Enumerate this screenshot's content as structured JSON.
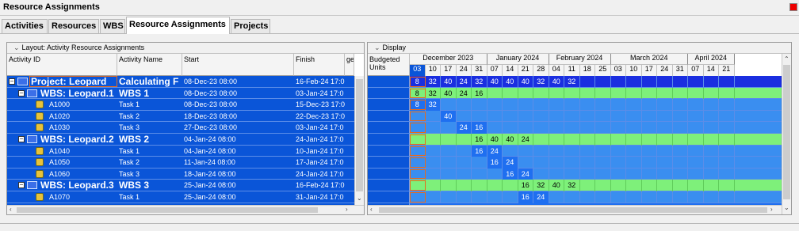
{
  "window": {
    "title": "Resource Assignments"
  },
  "tabs": [
    {
      "label": "Activities"
    },
    {
      "label": "Resources"
    },
    {
      "label": "WBS"
    },
    {
      "label": "Resource Assignments"
    },
    {
      "label": "Projects"
    }
  ],
  "left_panel": {
    "layout_label": "Layout: Activity Resource Assignments",
    "columns": [
      "Activity ID",
      "Activity Name",
      "Start",
      "Finish",
      "ge"
    ],
    "rows": [
      {
        "type": "proj",
        "id": "Project: Leopard",
        "name": "Calculating F",
        "start": "08-Dec-23 08:00",
        "finish": "16-Feb-24 17:0"
      },
      {
        "type": "wbs",
        "id": "WBS: Leopard.1",
        "name": "WBS 1",
        "start": "08-Dec-23 08:00",
        "finish": "03-Jan-24 17:0"
      },
      {
        "type": "act",
        "id": "A1000",
        "name": "Task 1",
        "start": "08-Dec-23 08:00",
        "finish": "15-Dec-23 17:0"
      },
      {
        "type": "act",
        "id": "A1020",
        "name": "Task 2",
        "start": "18-Dec-23 08:00",
        "finish": "22-Dec-23 17:0"
      },
      {
        "type": "act",
        "id": "A1030",
        "name": "Task 3",
        "start": "27-Dec-23 08:00",
        "finish": "03-Jan-24 17:0"
      },
      {
        "type": "wbs",
        "id": "WBS: Leopard.2",
        "name": "WBS 2",
        "start": "04-Jan-24 08:00",
        "finish": "24-Jan-24 17:0"
      },
      {
        "type": "act",
        "id": "A1040",
        "name": "Task 1",
        "start": "04-Jan-24 08:00",
        "finish": "10-Jan-24 17:0"
      },
      {
        "type": "act",
        "id": "A1050",
        "name": "Task 2",
        "start": "11-Jan-24 08:00",
        "finish": "17-Jan-24 17:0"
      },
      {
        "type": "act",
        "id": "A1060",
        "name": "Task 3",
        "start": "18-Jan-24 08:00",
        "finish": "24-Jan-24 17:0"
      },
      {
        "type": "wbs",
        "id": "WBS: Leopard.3",
        "name": "WBS 3",
        "start": "25-Jan-24 08:00",
        "finish": "16-Feb-24 17:0"
      },
      {
        "type": "act",
        "id": "A1070",
        "name": "Task 1",
        "start": "25-Jan-24 08:00",
        "finish": "31-Jan-24 17:0"
      }
    ]
  },
  "right_panel": {
    "display_label": "Display",
    "budgeted_label": "Budgeted Units",
    "months": [
      "December 2023",
      "January 2024",
      "February 2024",
      "March 2024",
      "April 2024"
    ],
    "days": [
      "03",
      "10",
      "17",
      "24",
      "31",
      "07",
      "14",
      "21",
      "28",
      "04",
      "11",
      "18",
      "25",
      "03",
      "10",
      "17",
      "24",
      "31",
      "07",
      "14",
      "21"
    ],
    "row_values": [
      [
        "8",
        "32",
        "40",
        "24",
        "32",
        "40",
        "40",
        "40",
        "32",
        "40",
        "32",
        "",
        "",
        "",
        "",
        "",
        "",
        "",
        "",
        "",
        ""
      ],
      [
        "8",
        "32",
        "40",
        "24",
        "16",
        "",
        "",
        "",
        "",
        "",
        "",
        "",
        "",
        "",
        "",
        "",
        "",
        "",
        "",
        "",
        ""
      ],
      [
        "8",
        "32",
        "",
        "",
        "",
        "",
        "",
        "",
        "",
        "",
        "",
        "",
        "",
        "",
        "",
        "",
        "",
        "",
        "",
        "",
        ""
      ],
      [
        "",
        "",
        "40",
        "",
        "",
        "",
        "",
        "",
        "",
        "",
        "",
        "",
        "",
        "",
        "",
        "",
        "",
        "",
        "",
        "",
        ""
      ],
      [
        "",
        "",
        "",
        "24",
        "16",
        "",
        "",
        "",
        "",
        "",
        "",
        "",
        "",
        "",
        "",
        "",
        "",
        "",
        "",
        "",
        ""
      ],
      [
        "",
        "",
        "",
        "",
        "16",
        "40",
        "40",
        "24",
        "",
        "",
        "",
        "",
        "",
        "",
        "",
        "",
        "",
        "",
        "",
        "",
        ""
      ],
      [
        "",
        "",
        "",
        "",
        "16",
        "24",
        "",
        "",
        "",
        "",
        "",
        "",
        "",
        "",
        "",
        "",
        "",
        "",
        "",
        "",
        ""
      ],
      [
        "",
        "",
        "",
        "",
        "",
        "16",
        "24",
        "",
        "",
        "",
        "",
        "",
        "",
        "",
        "",
        "",
        "",
        "",
        "",
        "",
        ""
      ],
      [
        "",
        "",
        "",
        "",
        "",
        "",
        "16",
        "24",
        "",
        "",
        "",
        "",
        "",
        "",
        "",
        "",
        "",
        "",
        "",
        "",
        ""
      ],
      [
        "",
        "",
        "",
        "",
        "",
        "",
        "",
        "16",
        "32",
        "40",
        "32",
        "",
        "",
        "",
        "",
        "",
        "",
        "",
        "",
        "",
        ""
      ],
      [
        "",
        "",
        "",
        "",
        "",
        "",
        "",
        "16",
        "24",
        "",
        "",
        "",
        "",
        "",
        "",
        "",
        "",
        "",
        "",
        "",
        ""
      ]
    ]
  },
  "colors": {
    "selection": "#0a55d8",
    "proj_bar": "#1a2ee0",
    "wbs_bar": "#7ef07a",
    "act_bar": "#3a8ef0"
  }
}
